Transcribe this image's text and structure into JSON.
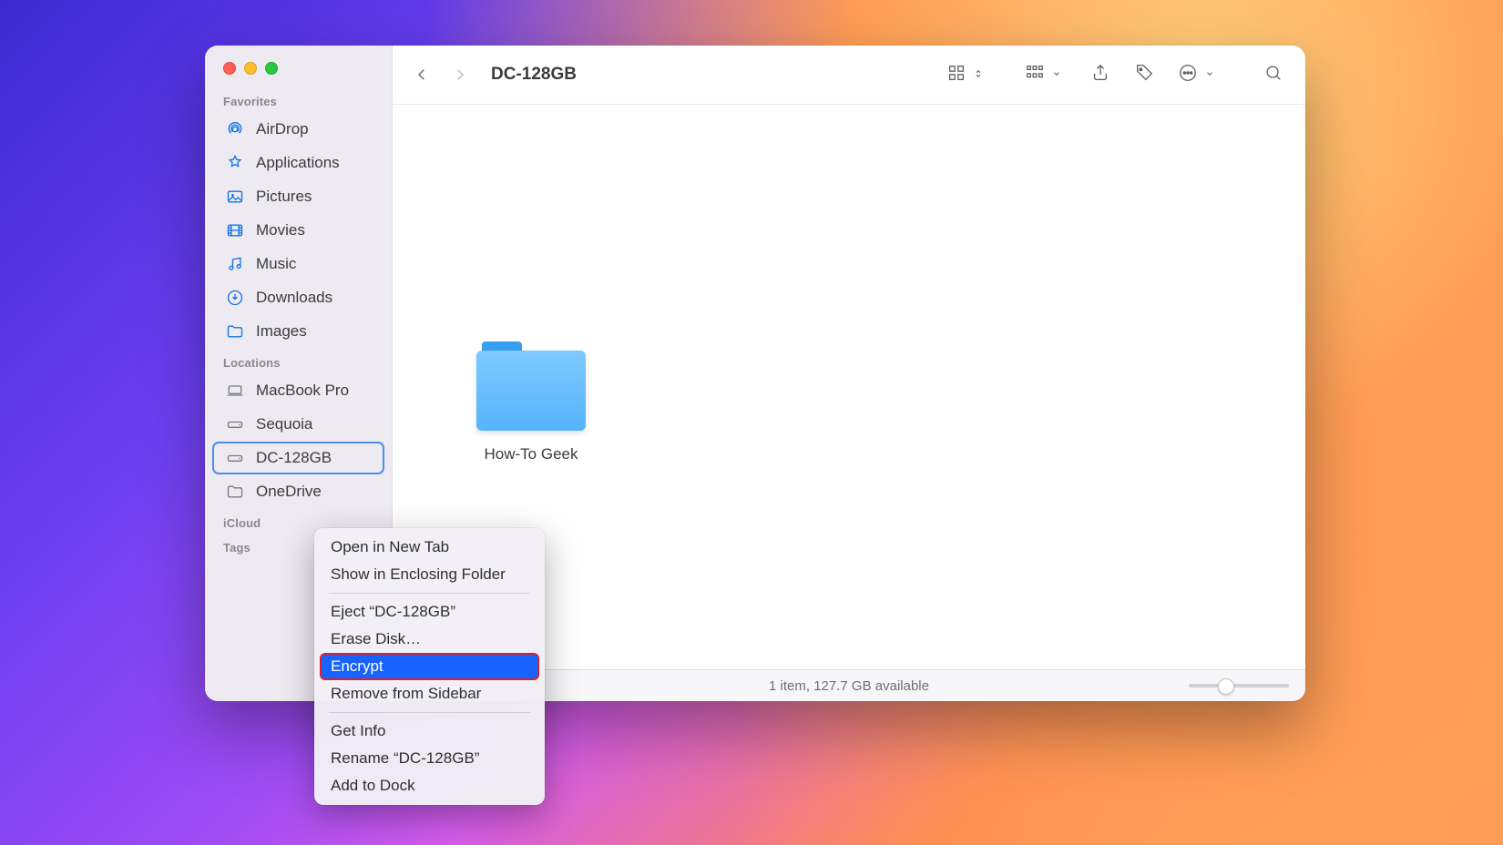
{
  "window": {
    "title": "DC-128GB"
  },
  "sidebar": {
    "sections": {
      "favorites": {
        "header": "Favorites",
        "items": [
          {
            "label": "AirDrop"
          },
          {
            "label": "Applications"
          },
          {
            "label": "Pictures"
          },
          {
            "label": "Movies"
          },
          {
            "label": "Music"
          },
          {
            "label": "Downloads"
          },
          {
            "label": "Images"
          }
        ]
      },
      "locations": {
        "header": "Locations",
        "items": [
          {
            "label": "MacBook Pro"
          },
          {
            "label": "Sequoia"
          },
          {
            "label": "DC-128GB"
          },
          {
            "label": "OneDrive"
          }
        ]
      },
      "icloud": {
        "header": "iCloud"
      },
      "tags": {
        "header": "Tags"
      }
    }
  },
  "content": {
    "items": [
      {
        "label": "How-To Geek"
      }
    ]
  },
  "statusbar": {
    "text": "1 item, 127.7 GB available"
  },
  "context_menu": {
    "items": [
      {
        "label": "Open in New Tab"
      },
      {
        "label": "Show in Enclosing Folder"
      },
      {
        "label": "Eject “DC-128GB”"
      },
      {
        "label": "Erase Disk…"
      },
      {
        "label": "Encrypt"
      },
      {
        "label": "Remove from Sidebar"
      },
      {
        "label": "Get Info"
      },
      {
        "label": "Rename “DC-128GB”"
      },
      {
        "label": "Add to Dock"
      }
    ]
  }
}
